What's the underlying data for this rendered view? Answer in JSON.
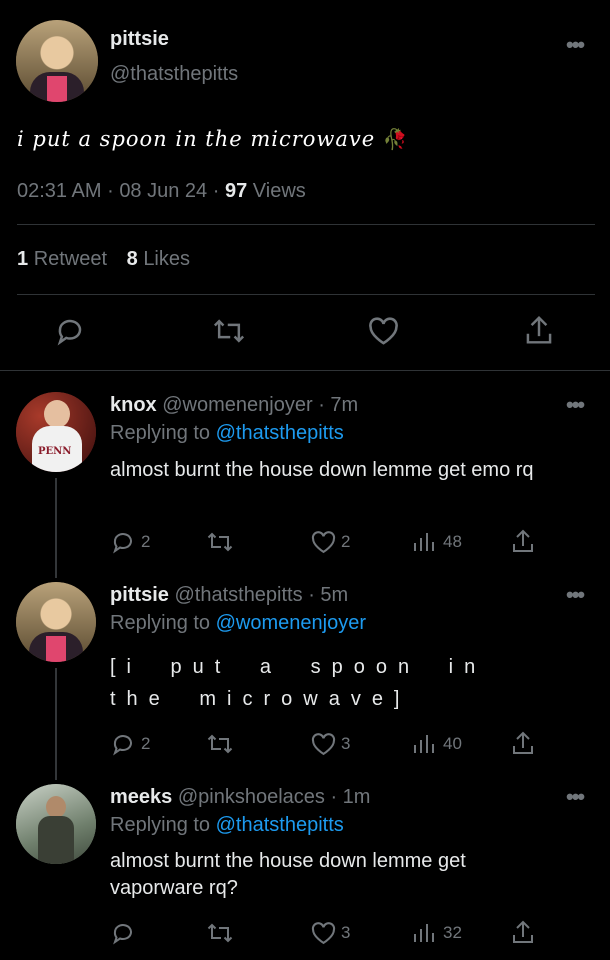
{
  "main_tweet": {
    "display_name": "pittsie",
    "handle": "@thatsthepitts",
    "text": "i put a spoon in the microwave",
    "emoji": "🥀",
    "time": "02:31 AM",
    "sep1": "·",
    "date": "08 Jun 24",
    "sep2": "·",
    "views_count": "97",
    "views_label": "Views",
    "retweets_count": "1",
    "retweets_label": "Retweet",
    "likes_count": "8",
    "likes_label": "Likes"
  },
  "replies": [
    {
      "display_name": "knox",
      "handle": "@womenenjoyer",
      "time": "· 7m",
      "replying_label": "Replying to",
      "replying_to": "@thatsthepitts",
      "text": "almost burnt the house down lemme get emo rq",
      "replies": "2",
      "retweets": "",
      "likes": "2",
      "views": "48"
    },
    {
      "display_name": "pittsie",
      "handle": "@thatsthepitts",
      "time": "· 5m",
      "replying_label": "Replying to",
      "replying_to": "@womenenjoyer",
      "text": "[i put a spoon in the microwave]",
      "replies": "2",
      "retweets": "",
      "likes": "3",
      "views": "40"
    },
    {
      "display_name": "meeks",
      "handle": "@pinkshoelaces",
      "time": "· 1m",
      "replying_label": "Replying to",
      "replying_to": "@thatsthepitts",
      "text": "almost burnt the house down lemme get vaporware rq?",
      "replies": "",
      "retweets": "",
      "likes": "3",
      "views": "32"
    }
  ],
  "more_glyph": "•••",
  "colors": {
    "background": "#000000",
    "text": "#e7e9ea",
    "secondary": "#71767b",
    "link": "#1d9bf0",
    "divider": "#2f3336"
  }
}
